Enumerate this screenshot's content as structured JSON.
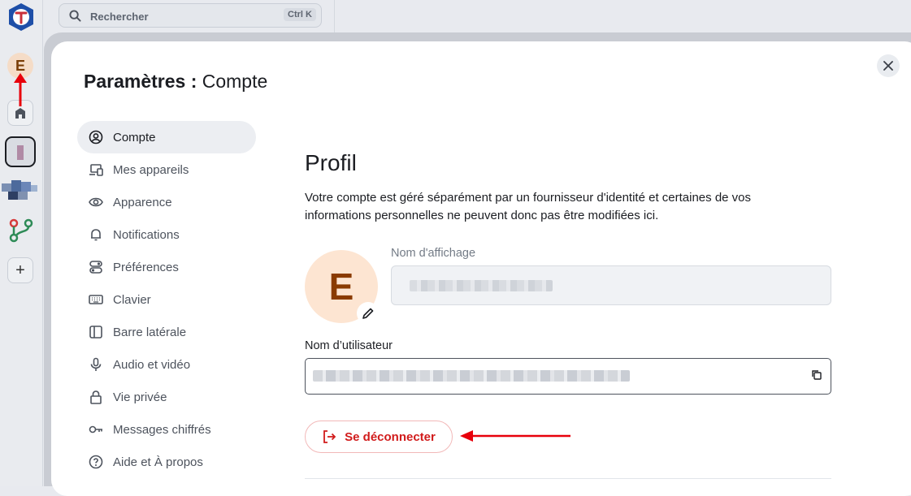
{
  "search": {
    "placeholder": "Rechercher",
    "shortcut": "Ctrl K"
  },
  "rail": {
    "avatar_initial": "E"
  },
  "modal": {
    "title_bold": "Paramètres :",
    "title_rest": "Compte",
    "nav": [
      {
        "label": "Compte",
        "icon": "user-circle-icon",
        "active": true
      },
      {
        "label": "Mes appareils",
        "icon": "devices-icon"
      },
      {
        "label": "Apparence",
        "icon": "eye-icon"
      },
      {
        "label": "Notifications",
        "icon": "bell-icon"
      },
      {
        "label": "Préférences",
        "icon": "toggles-icon"
      },
      {
        "label": "Clavier",
        "icon": "keyboard-icon"
      },
      {
        "label": "Barre latérale",
        "icon": "sidebar-icon"
      },
      {
        "label": "Audio et vidéo",
        "icon": "microphone-icon"
      },
      {
        "label": "Vie privée",
        "icon": "lock-icon"
      },
      {
        "label": "Messages chiffrés",
        "icon": "key-icon"
      },
      {
        "label": "Aide et À propos",
        "icon": "help-icon"
      }
    ]
  },
  "profile": {
    "heading": "Profil",
    "description": "Votre compte est géré séparément par un fournisseur d'identité et certaines de vos informations personnelles ne peuvent donc pas être modifiées ici.",
    "avatar_initial": "E",
    "display_name_label": "Nom d'affichage",
    "username_label": "Nom d’utilisateur",
    "logout_label": "Se déconnecter"
  },
  "colors": {
    "accent_red": "#d11b1b",
    "avatar_bg": "#fde5d2",
    "annotation_red": "#e8000b"
  }
}
